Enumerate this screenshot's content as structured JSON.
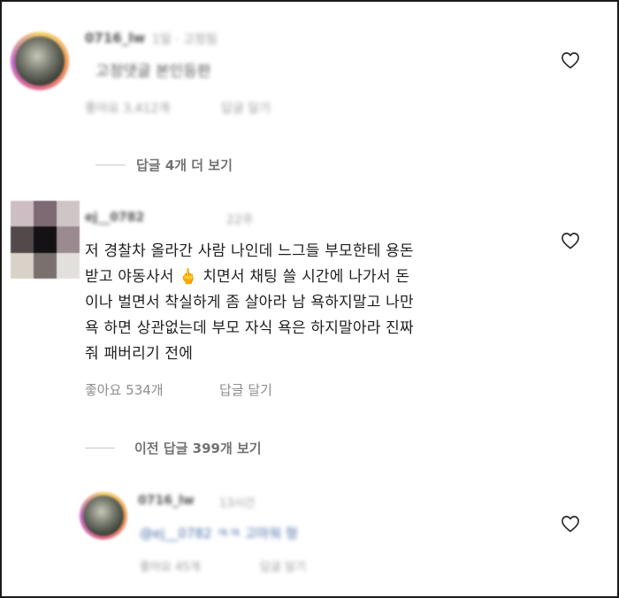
{
  "comments": [
    {
      "username": "0716_lw",
      "time": "1일 · 고정됨",
      "text": "고정댓글 본인등판",
      "likes": "좋아요 3,412개",
      "reply_label": "답글 달기"
    },
    {
      "username": "ej__0782",
      "time": "22주",
      "text_lines": [
        "저 경찰차 올라간 사람 나인데 느그들 부모한테 용돈",
        "받고 야동사서 🖕 치면서 채팅 쓸 시간에 나가서 돈",
        "이나 벌면서 착실하게 좀 살아라 남 욕하지말고 나만",
        "욕 하면 상관없는데 부모 자식 욕은 하지말아라 진짜",
        "줘 패버리기 전에"
      ],
      "likes": "좋아요 534개",
      "reply_label": "답글 달기"
    },
    {
      "username": "0716_lw",
      "time": "13시간",
      "text": "@ej__0782 ㅋㅋ 고마워 형",
      "likes": "좋아요 45개",
      "reply_label": "답글 달기"
    }
  ],
  "view_more_replies_1": "답글 4개 더 보기",
  "view_previous_replies": "이전 답글 399개 보기"
}
